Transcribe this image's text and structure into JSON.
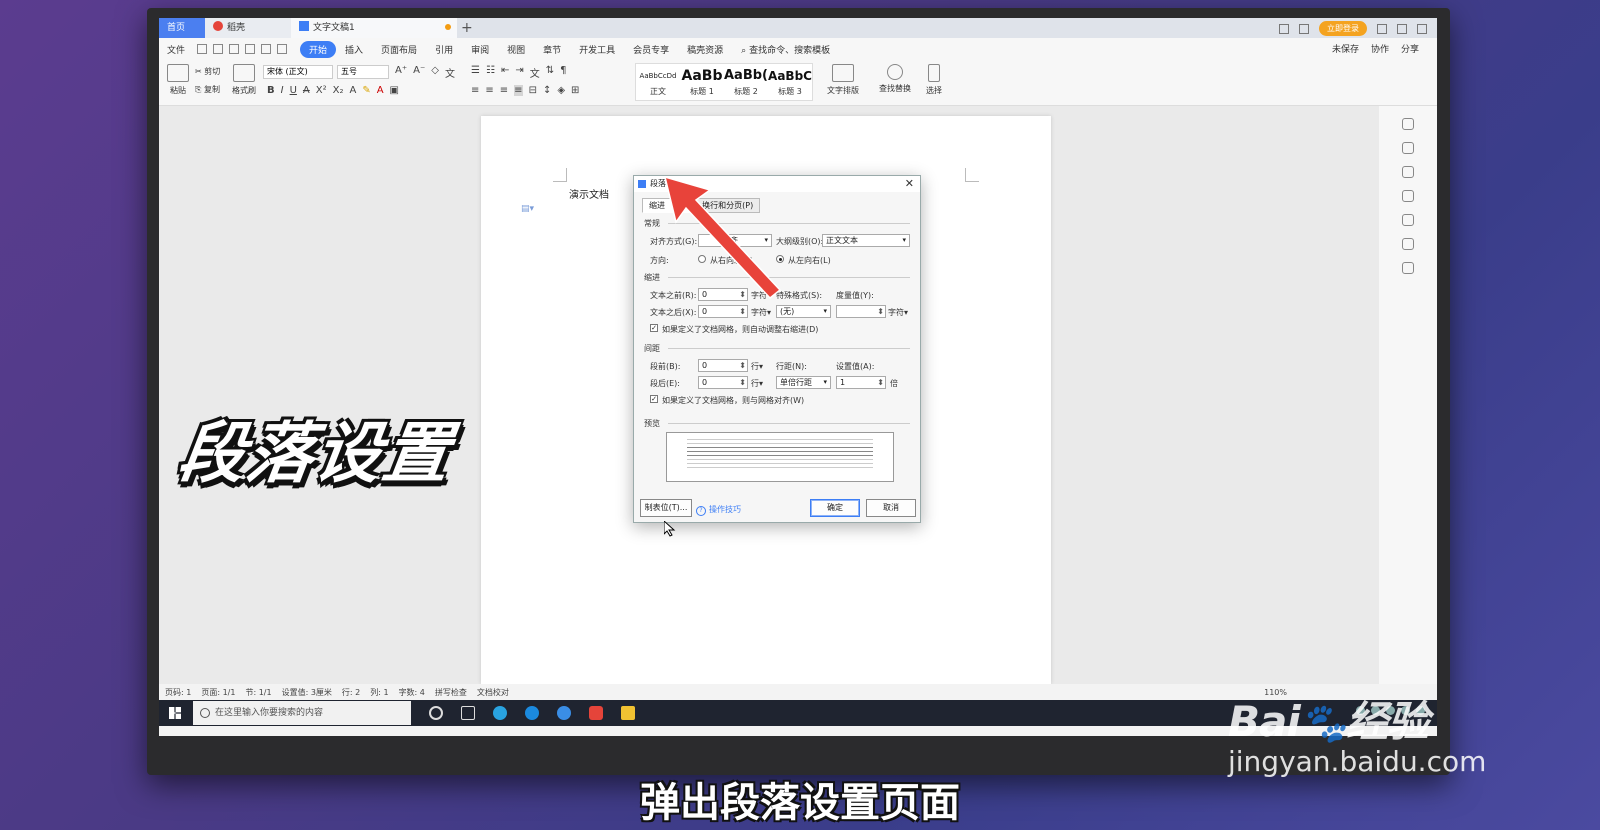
{
  "tabs": {
    "home": "首页",
    "wps": "稻壳",
    "doc": "文字文稿1"
  },
  "titlebar": {
    "login": "立即登录"
  },
  "menu": {
    "items": [
      "文件",
      "开始",
      "插入",
      "页面布局",
      "引用",
      "审阅",
      "视图",
      "章节",
      "开发工具",
      "会员专享",
      "稿壳资源"
    ],
    "search": "查找命令、搜索模板",
    "right": [
      "未保存",
      "协作",
      "分享"
    ]
  },
  "ribbon": {
    "paste": "粘贴",
    "cut": "剪切",
    "copy": "复制",
    "format_painter": "格式刷",
    "font": "宋体 (正文)",
    "size": "五号",
    "styles": [
      {
        "preview": "AaBbCcDd",
        "label": "正文"
      },
      {
        "preview": "AaBb",
        "label": "标题 1"
      },
      {
        "preview": "AaBb(",
        "label": "标题 2"
      },
      {
        "preview": "AaBbC",
        "label": "标题 3"
      }
    ],
    "text_layout": "文字排版",
    "find_replace": "查找替换",
    "select": "选择"
  },
  "document": {
    "text": "演示文档"
  },
  "dialog": {
    "title": "段落",
    "tab_indent": "缩进",
    "tab_indent_suffix": ")",
    "tab_break": "换行和分页(P)",
    "sec_general": "常规",
    "align_label": "对齐方式(G):",
    "align_value": "对齐",
    "outline_label": "大纲级别(O):",
    "outline_value": "正文文本",
    "direction_label": "方向:",
    "rtl": "从右向左(F)",
    "ltr": "从左向右(L)",
    "sec_indent": "缩进",
    "before_text_label": "文本之前(R):",
    "before_text_value": "0",
    "after_text_label": "文本之后(X):",
    "after_text_value": "0",
    "unit_char": "字符▾",
    "special_label": "特殊格式(S):",
    "special_value": "(无)",
    "measure_label": "度量值(Y):",
    "measure_value": "",
    "auto_indent_check": "如果定义了文档网格，则自动调整右缩进(D)",
    "sec_spacing": "间距",
    "before_label": "段前(B):",
    "before_value": "0",
    "after_label": "段后(E):",
    "after_value": "0",
    "unit_line": "行▾",
    "line_spacing_label": "行距(N):",
    "line_spacing_value": "单倍行距",
    "setting_label": "设置值(A):",
    "setting_value": "1",
    "unit_times": "倍",
    "grid_check": "如果定义了文档网格，则与网格对齐(W)",
    "sec_preview": "预览",
    "tabs_button": "制表位(T)...",
    "tips": "操作技巧",
    "ok": "确定",
    "cancel": "取消"
  },
  "statusbar": {
    "items": [
      "页码: 1",
      "页面: 1/1",
      "节: 1/1",
      "设置值: 3厘米",
      "行: 2",
      "列: 1",
      "字数: 4",
      "拼写检查",
      "文档校对"
    ],
    "zoom": "110%"
  },
  "taskbar": {
    "search_placeholder": "在这里输入你要搜索的内容"
  },
  "overlay": {
    "big_title": "段落设置",
    "subtitle": "弹出段落设置页面"
  },
  "watermark": {
    "logo_left": "Bai",
    "logo_right": "经验",
    "url": "jingyan.baidu.com"
  },
  "colors": {
    "accent": "#3d7ef5",
    "arrow": "#e8433a"
  }
}
